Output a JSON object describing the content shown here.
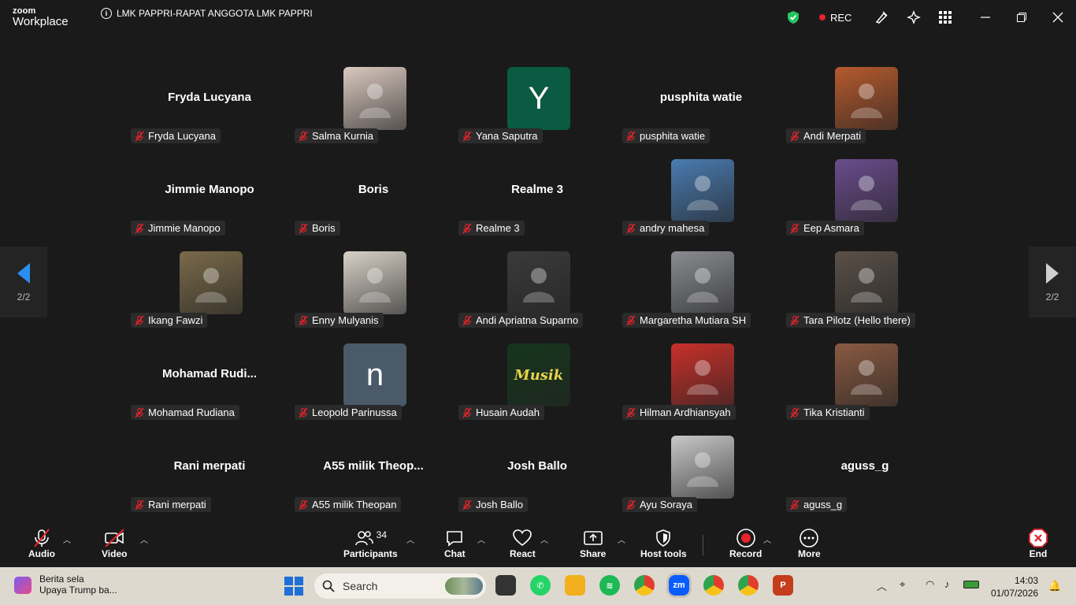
{
  "app": {
    "brand_top": "zoom",
    "brand_bottom": "Workplace",
    "meeting_title": "LMK PAPPRI-RAPAT ANGGOTA LMK PAPPRI",
    "rec_label": "REC",
    "accent": "#0e72ed",
    "rec_color": "#e8232a"
  },
  "gallery": {
    "page_indicator_left": "2/2",
    "page_indicator_right": "2/2",
    "tiles": [
      {
        "display": "Fryda Lucyana",
        "label": "Fryda Lucyana",
        "kind": "name"
      },
      {
        "display": "",
        "label": "Salma Kurnia",
        "kind": "photo",
        "color": "#d9c9bf"
      },
      {
        "display": "Y",
        "label": "Yana Saputra",
        "kind": "letter",
        "color": "#0b5a42"
      },
      {
        "display": "pusphita watie",
        "label": "pusphita watie",
        "kind": "name"
      },
      {
        "display": "",
        "label": "Andi Merpati",
        "kind": "photo",
        "color": "#b55a2e"
      },
      {
        "display": "Jimmie Manopo",
        "label": "Jimmie Manopo",
        "kind": "name"
      },
      {
        "display": "Boris",
        "label": "Boris",
        "kind": "name"
      },
      {
        "display": "Realme 3",
        "label": "Realme 3",
        "kind": "name"
      },
      {
        "display": "",
        "label": "andry mahesa",
        "kind": "photo",
        "color": "#4a7bb0"
      },
      {
        "display": "",
        "label": "Eep Asmara",
        "kind": "photo",
        "color": "#6a4c8c"
      },
      {
        "display": "",
        "label": "Ikang Fawzi",
        "kind": "photo",
        "color": "#7a6a4a"
      },
      {
        "display": "",
        "label": "Enny Mulyanis",
        "kind": "photo",
        "color": "#d8d2c8"
      },
      {
        "display": "",
        "label": "Andi Apriatna Suparno",
        "kind": "photo",
        "color": "#3a3a3a"
      },
      {
        "display": "",
        "label": "Margaretha Mutiara SH",
        "kind": "photo",
        "color": "#8a8c90"
      },
      {
        "display": "",
        "label": "Tara Pilotz (Hello there)",
        "kind": "photo",
        "color": "#5a5048"
      },
      {
        "display": "Mohamad  Rudi...",
        "label": "Mohamad Rudiana",
        "kind": "name"
      },
      {
        "display": "n",
        "label": "Leopold Parinussa",
        "kind": "letter",
        "color": "#4a5a68"
      },
      {
        "display": "Musik",
        "label": "Husain Audah",
        "kind": "photo",
        "color": "#15361c"
      },
      {
        "display": "",
        "label": "Hilman Ardhiansyah",
        "kind": "photo",
        "color": "#c8302a"
      },
      {
        "display": "",
        "label": "Tika Kristianti",
        "kind": "photo",
        "color": "#8a5a42"
      },
      {
        "display": "Rani merpati",
        "label": "Rani merpati",
        "kind": "name"
      },
      {
        "display": "A55  milik  Theop...",
        "label": "A55 milik Theopan",
        "kind": "name"
      },
      {
        "display": "Josh Ballo",
        "label": "Josh Ballo",
        "kind": "name"
      },
      {
        "display": "",
        "label": "Ayu Soraya",
        "kind": "photo",
        "color": "#c8c8c8"
      },
      {
        "display": "aguss_g",
        "label": "aguss_g",
        "kind": "name"
      }
    ]
  },
  "toolbar": {
    "audio": "Audio",
    "video": "Video",
    "participants": "Participants",
    "participants_count": "34",
    "chat": "Chat",
    "react": "React",
    "share": "Share",
    "host_tools": "Host tools",
    "record": "Record",
    "more": "More",
    "end": "End"
  },
  "taskbar": {
    "news_title": "Berita sela",
    "news_sub": "Upaya Trump ba...",
    "search_placeholder": "Search",
    "time": "14:03",
    "date": "01/07/2026"
  }
}
